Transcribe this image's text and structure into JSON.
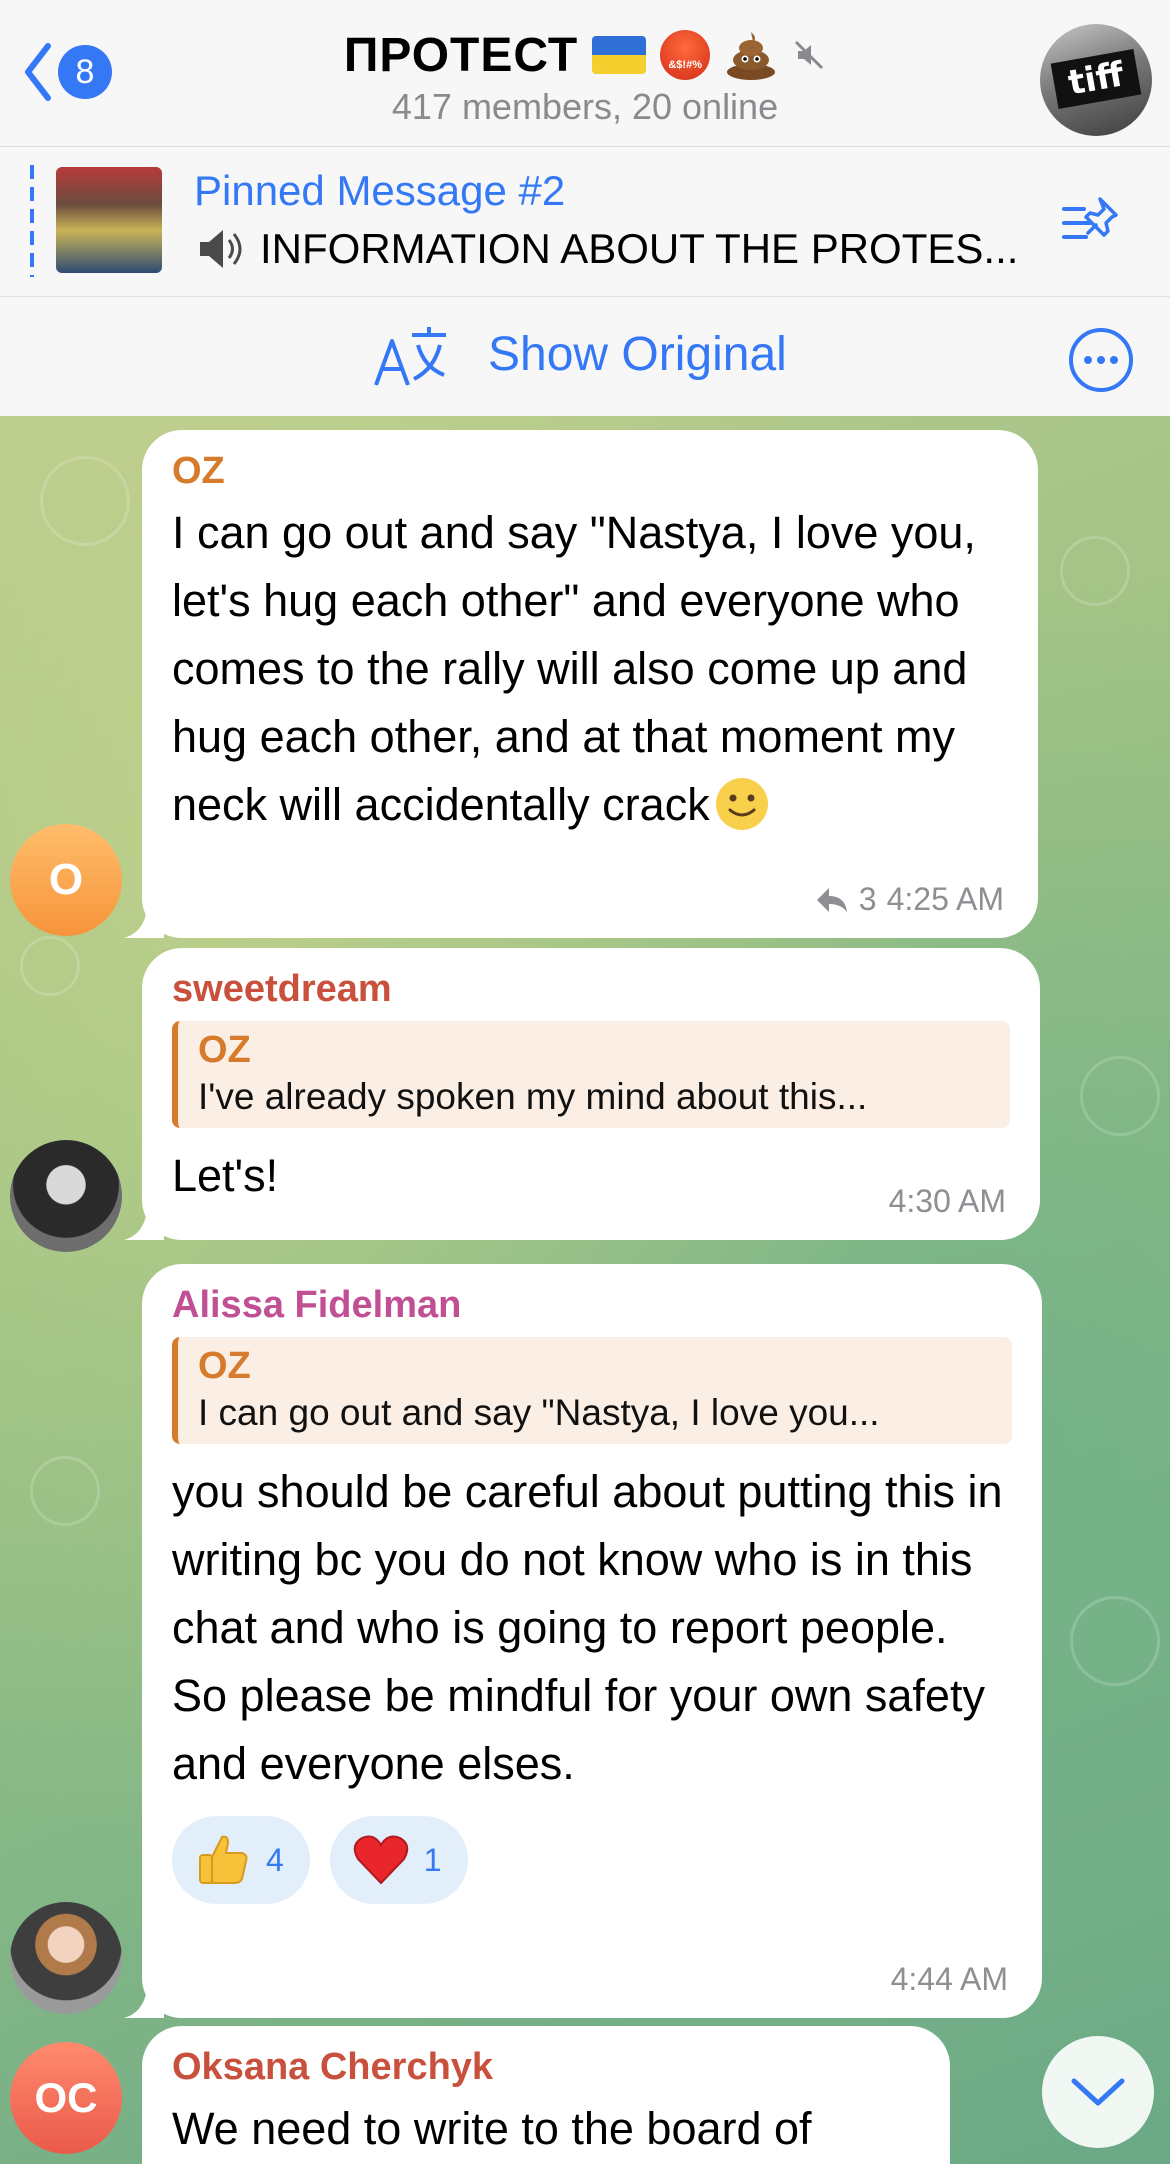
{
  "header": {
    "back_badge": "8",
    "title": "ПРОТЕСТ",
    "emoji_symbols": "&$!#%",
    "subtitle": "417 members, 20 online",
    "avatar_text": "tiff"
  },
  "pinned": {
    "title": "Pinned Message #2",
    "text": "INFORMATION ABOUT THE PROTES..."
  },
  "translate_bar": {
    "label": "Show Original"
  },
  "messages": [
    {
      "sender": "OZ",
      "sender_color": "#d67a2c",
      "avatar_initials": "O",
      "text": "I can go out and say \"Nastya, I love you, let's hug each other\" and everyone who comes to the rally will also come up and hug each other, and at that moment my neck will accidentally crack",
      "replies": "3",
      "time": "4:25 AM"
    },
    {
      "sender": "sweetdream",
      "sender_color": "#c8503c",
      "reply_to": {
        "name": "OZ",
        "text": "I've already spoken my mind about this..."
      },
      "text": "Let's!",
      "time": "4:30 AM"
    },
    {
      "sender": "Alissa Fidelman",
      "sender_color": "#c14f93",
      "reply_to": {
        "name": "OZ",
        "text": "I can go out and say \"Nastya, I love you..."
      },
      "text": "you should be careful about putting this in writing bc you do not know who is in this chat and who is going to report people. So please be mindful for your own safety and everyone elses.",
      "reactions": [
        {
          "emoji": "thumbs-up",
          "count": "4"
        },
        {
          "emoji": "heart",
          "count": "1"
        }
      ],
      "time": "4:44 AM"
    },
    {
      "sender": "Oksana Cherchyk",
      "sender_color": "#c8503c",
      "avatar_initials": "OC",
      "text": "We need to write to the board of"
    }
  ],
  "colors": {
    "accent": "#3478f6",
    "header_bg": "#f7f7f7"
  }
}
